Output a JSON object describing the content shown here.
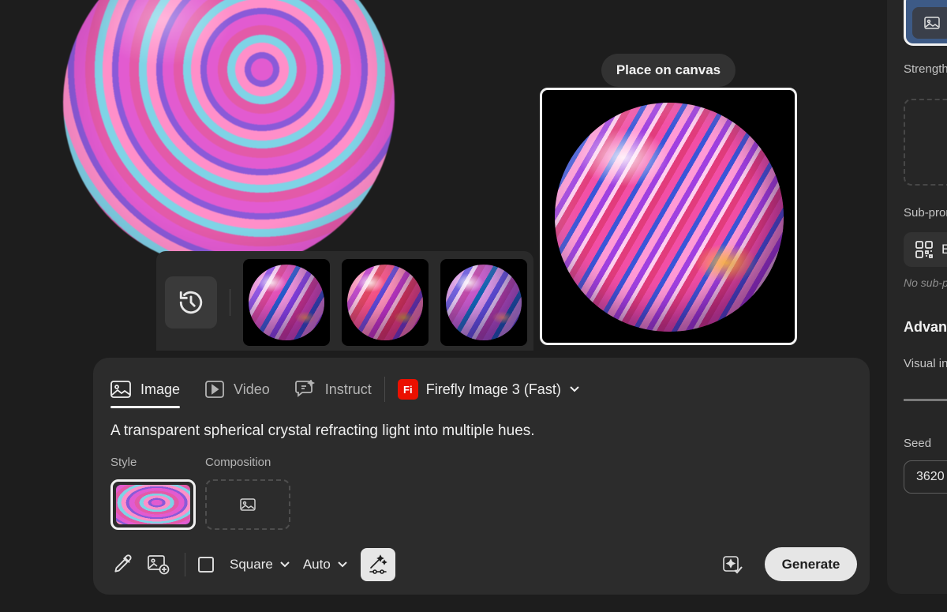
{
  "canvas": {
    "place_button": "Place on canvas"
  },
  "history": {
    "icon": "history-icon",
    "thumbnails": [
      "crystal-sphere-1",
      "crystal-sphere-2",
      "crystal-sphere-3"
    ]
  },
  "prompt_panel": {
    "tabs": [
      {
        "label": "Image",
        "icon": "image-icon",
        "active": true
      },
      {
        "label": "Video",
        "icon": "video-icon",
        "active": false
      },
      {
        "label": "Instruct",
        "icon": "instruct-icon",
        "active": false
      }
    ],
    "model": {
      "badge": "Fi",
      "label": "Firefly Image 3 (Fast)"
    },
    "prompt_text": "A transparent spherical crystal refracting light into multiple hues.",
    "style_label": "Style",
    "composition_label": "Composition",
    "toolbar": {
      "aspect_label": "Square",
      "content_type_label": "Auto",
      "generate_label": "Generate"
    }
  },
  "settings_panel": {
    "strength_label": "Strength",
    "sub_prompts_label": "Sub-prom",
    "sub_prompt_pill": "E",
    "no_sub_prompts": "No sub-p",
    "advanced_heading": "Advanc",
    "visual_intensity_label": "Visual in",
    "seed_label": "Seed",
    "seed_value": "3620"
  },
  "colors": {
    "background": "#1d1d1d",
    "panel": "#2c2c2c",
    "firefly_badge": "#eb1000",
    "primary_button": "#e6e6e6"
  }
}
